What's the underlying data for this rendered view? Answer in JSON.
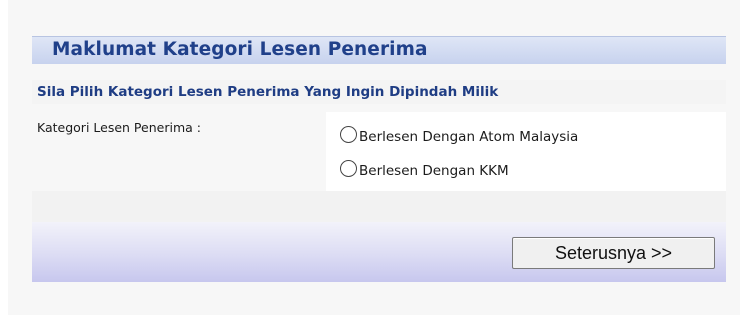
{
  "panel": {
    "title": "Maklumat Kategori Lesen Penerima",
    "instruction": "Sila Pilih Kategori Lesen Penerima Yang Ingin Dipindah Milik"
  },
  "form": {
    "field_label": "Kategori Lesen Penerima :",
    "options": [
      {
        "label": "Berlesen Dengan Atom Malaysia",
        "selected": false
      },
      {
        "label": "Berlesen Dengan KKM",
        "selected": false
      }
    ]
  },
  "actions": {
    "next_label": "Seterusnya >>"
  },
  "colors": {
    "title_text": "#20408a",
    "header_bg": "#c7d2ee",
    "footer_gradient_end": "#c7c7ee"
  }
}
